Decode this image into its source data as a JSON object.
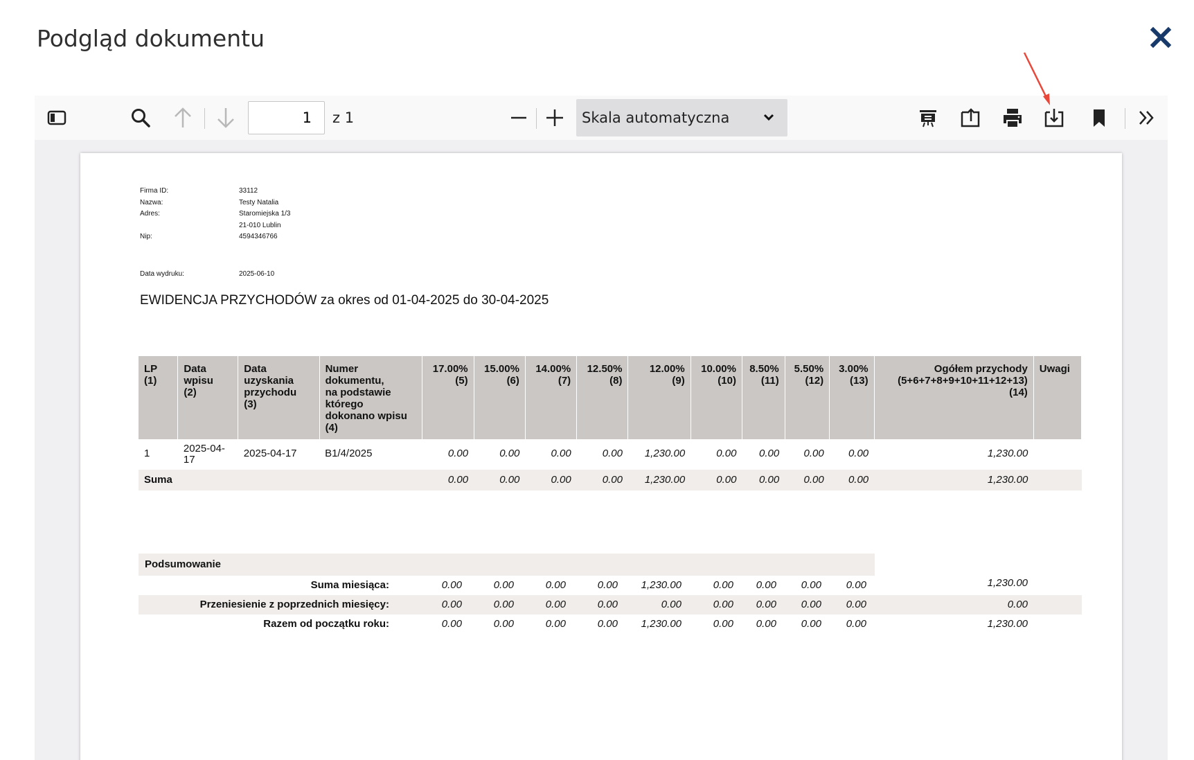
{
  "dialog": {
    "title": "Podgląd dokumentu"
  },
  "toolbar": {
    "page_current": "1",
    "page_count_label": "z 1",
    "scale_label": "Skala automatyczna"
  },
  "document": {
    "info": [
      {
        "label": "Firma ID:",
        "value": "33112"
      },
      {
        "label": "Nazwa:",
        "value": "Testy Natalia"
      },
      {
        "label": "Adres:",
        "value": "Staromiejska 1/3"
      },
      {
        "label": "",
        "value": "21-010 Lublin"
      },
      {
        "label": "Nip:",
        "value": "4594346766"
      }
    ],
    "print_date_label": "Data wydruku:",
    "print_date_value": "2025-06-10",
    "title": "EWIDENCJA PRZYCHODÓW za okres od 01-04-2025 do 30-04-2025",
    "headers": [
      "LP\n(1)",
      "Data\nwpisu\n(2)",
      "Data\nuzyskania\nprzychodu\n(3)",
      "Numer\ndokumentu,\nna podstawie\nktórego\ndokonano wpisu\n(4)",
      "17.00%\n(5)",
      "15.00%\n(6)",
      "14.00%\n(7)",
      "12.50%\n(8)",
      "12.00%\n(9)",
      "10.00%\n(10)",
      "8.50%\n(11)",
      "5.50%\n(12)",
      "3.00%\n(13)",
      "Ogółem przychody\n(5+6+7+8+9+10+11+12+13)\n(14)",
      "Uwagi"
    ],
    "rows": [
      [
        "1",
        "2025-04-\n17",
        "2025-04-17",
        "B1/4/2025",
        "0.00",
        "0.00",
        "0.00",
        "0.00",
        "1,230.00",
        "0.00",
        "0.00",
        "0.00",
        "0.00",
        "1,230.00",
        ""
      ]
    ],
    "sum_row": {
      "label": "Suma",
      "values": [
        "0.00",
        "0.00",
        "0.00",
        "0.00",
        "1,230.00",
        "0.00",
        "0.00",
        "0.00",
        "0.00",
        "1,230.00"
      ]
    },
    "summary": {
      "header": "Podsumowanie",
      "rows": [
        {
          "label": "Suma miesiąca:",
          "values": [
            "0.00",
            "0.00",
            "0.00",
            "0.00",
            "1,230.00",
            "0.00",
            "0.00",
            "0.00",
            "0.00"
          ],
          "total": "1,230.00"
        },
        {
          "label": "Przeniesienie z poprzednich miesięcy:",
          "values": [
            "0.00",
            "0.00",
            "0.00",
            "0.00",
            "0.00",
            "0.00",
            "0.00",
            "0.00",
            "0.00"
          ],
          "total": "0.00"
        },
        {
          "label": "Razem od początku roku:",
          "values": [
            "0.00",
            "0.00",
            "0.00",
            "0.00",
            "1,230.00",
            "0.00",
            "0.00",
            "0.00",
            "0.00"
          ],
          "total": "1,230.00"
        }
      ]
    }
  },
  "colors": {
    "accent_close": "#173a6b",
    "annotation_arrow": "#e8473a",
    "table_header_bg": "#cbc7c4",
    "row_shade": "#f0edeb"
  },
  "icons": [
    "close-icon",
    "sidebar-toggle-icon",
    "search-icon",
    "arrow-up-icon",
    "arrow-down-icon",
    "minus-icon",
    "plus-icon",
    "chevron-down-icon",
    "presentation-icon",
    "open-file-icon",
    "print-icon",
    "download-icon",
    "bookmark-icon",
    "double-chevron-right-icon"
  ]
}
